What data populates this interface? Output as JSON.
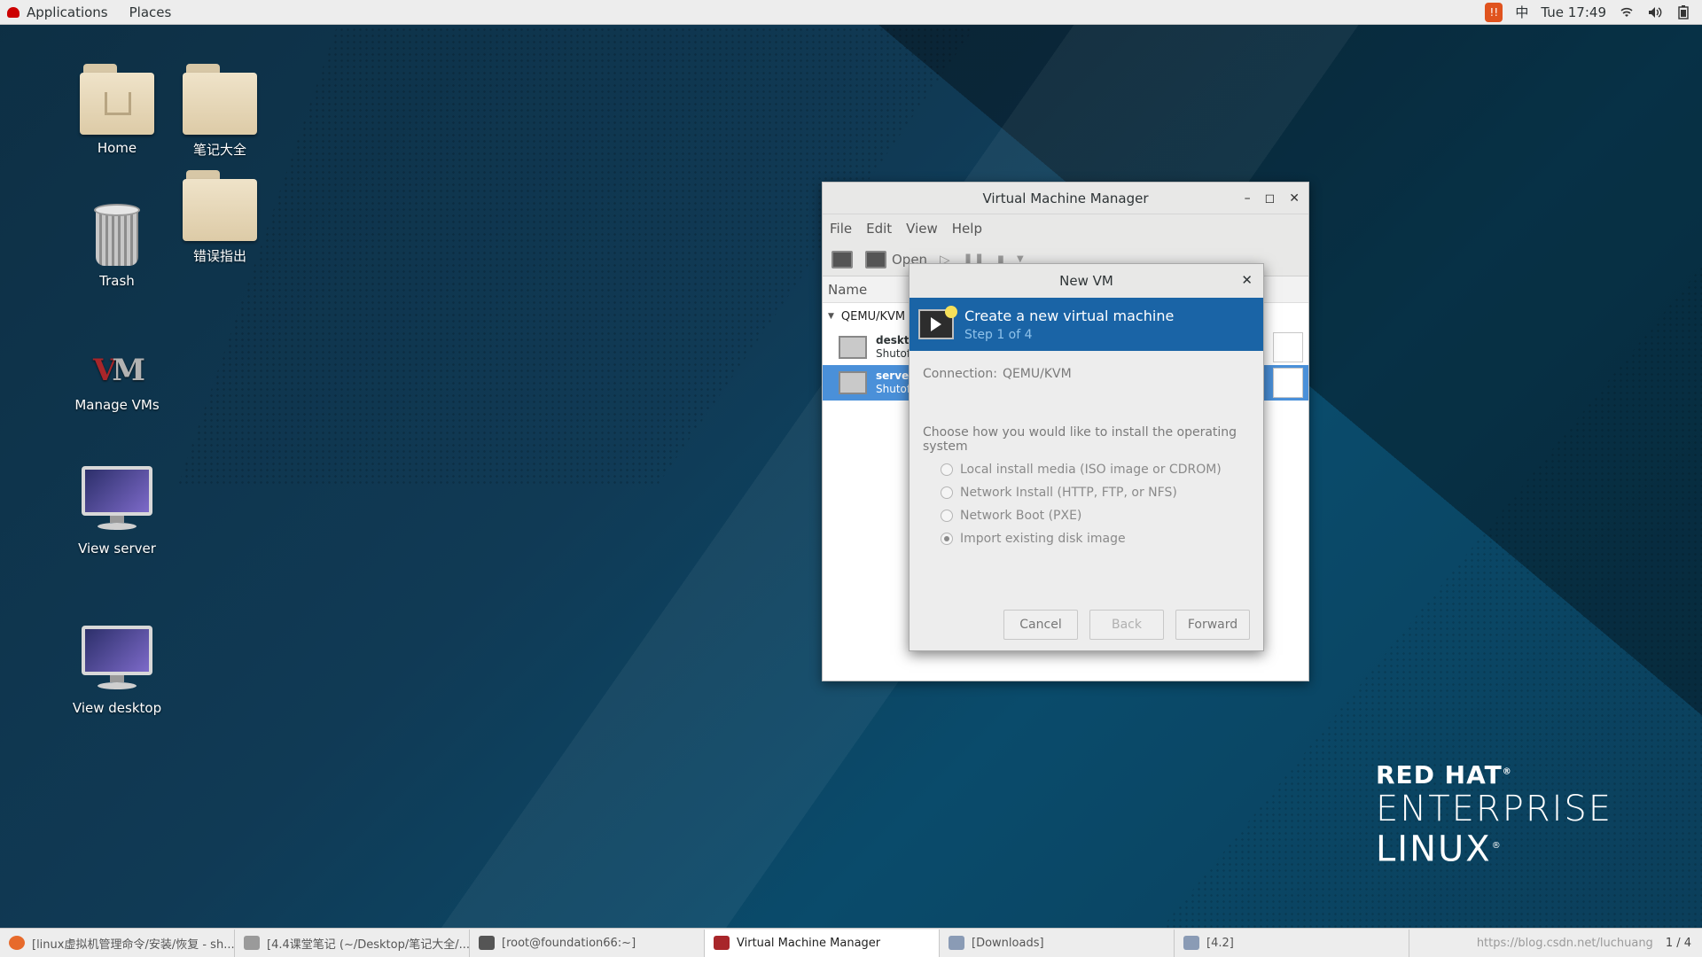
{
  "topbar": {
    "applications": "Applications",
    "places": "Places",
    "input_method": "中",
    "clock": "Tue 17:49",
    "alert_text": "!!"
  },
  "desktop": {
    "icons": [
      {
        "label": "Home"
      },
      {
        "label": "笔记大全"
      },
      {
        "label": "Trash"
      },
      {
        "label": "错误指出"
      },
      {
        "label": "Manage VMs"
      },
      {
        "label": "View server"
      },
      {
        "label": "View desktop"
      }
    ],
    "brand": {
      "line1": "RED HAT",
      "line2": "ENTERPRISE",
      "line3": "LINUX"
    },
    "brand_mark_r": "®"
  },
  "vmm": {
    "title": "Virtual Machine Manager",
    "menu": [
      "File",
      "Edit",
      "View",
      "Help"
    ],
    "toolbar_open": "Open",
    "column_name": "Name",
    "group": "QEMU/KVM",
    "vms": [
      {
        "name": "deskto",
        "state": "Shutoff"
      },
      {
        "name": "server",
        "state": "Shutoff"
      }
    ]
  },
  "dialog": {
    "title": "New VM",
    "banner_title": "Create a new virtual machine",
    "banner_step": "Step 1 of 4",
    "connection_label": "Connection:",
    "connection_value": "QEMU/KVM",
    "choose": "Choose how you would like to install the operating system",
    "options": [
      {
        "label": "Local install media (ISO image or CDROM)",
        "selected": false
      },
      {
        "label": "Network Install (HTTP, FTP, or NFS)",
        "selected": false
      },
      {
        "label": "Network Boot (PXE)",
        "selected": false
      },
      {
        "label": "Import existing disk image",
        "selected": true
      }
    ],
    "buttons": {
      "cancel": "Cancel",
      "back": "Back",
      "forward": "Forward"
    }
  },
  "taskbar": {
    "tasks": [
      {
        "label": "[linux虚拟机管理命令/安装/恢复 - sh...",
        "color": "#e76a2b"
      },
      {
        "label": "[4.4课堂笔记 (~/Desktop/笔记大全/...",
        "color": "#9a9a9a"
      },
      {
        "label": "[root@foundation66:~]",
        "color": "#555555"
      },
      {
        "label": "Virtual Machine Manager",
        "color": "#a8262a"
      },
      {
        "label": "[Downloads]",
        "color": "#8a9bb5"
      },
      {
        "label": "[4.2]",
        "color": "#8a9bb5"
      }
    ],
    "watermark": "https://blog.csdn.net/luchuang",
    "workspace": "1 / 4"
  },
  "colors": {
    "accent": "#1a64a6",
    "selection": "#4a90d9"
  }
}
